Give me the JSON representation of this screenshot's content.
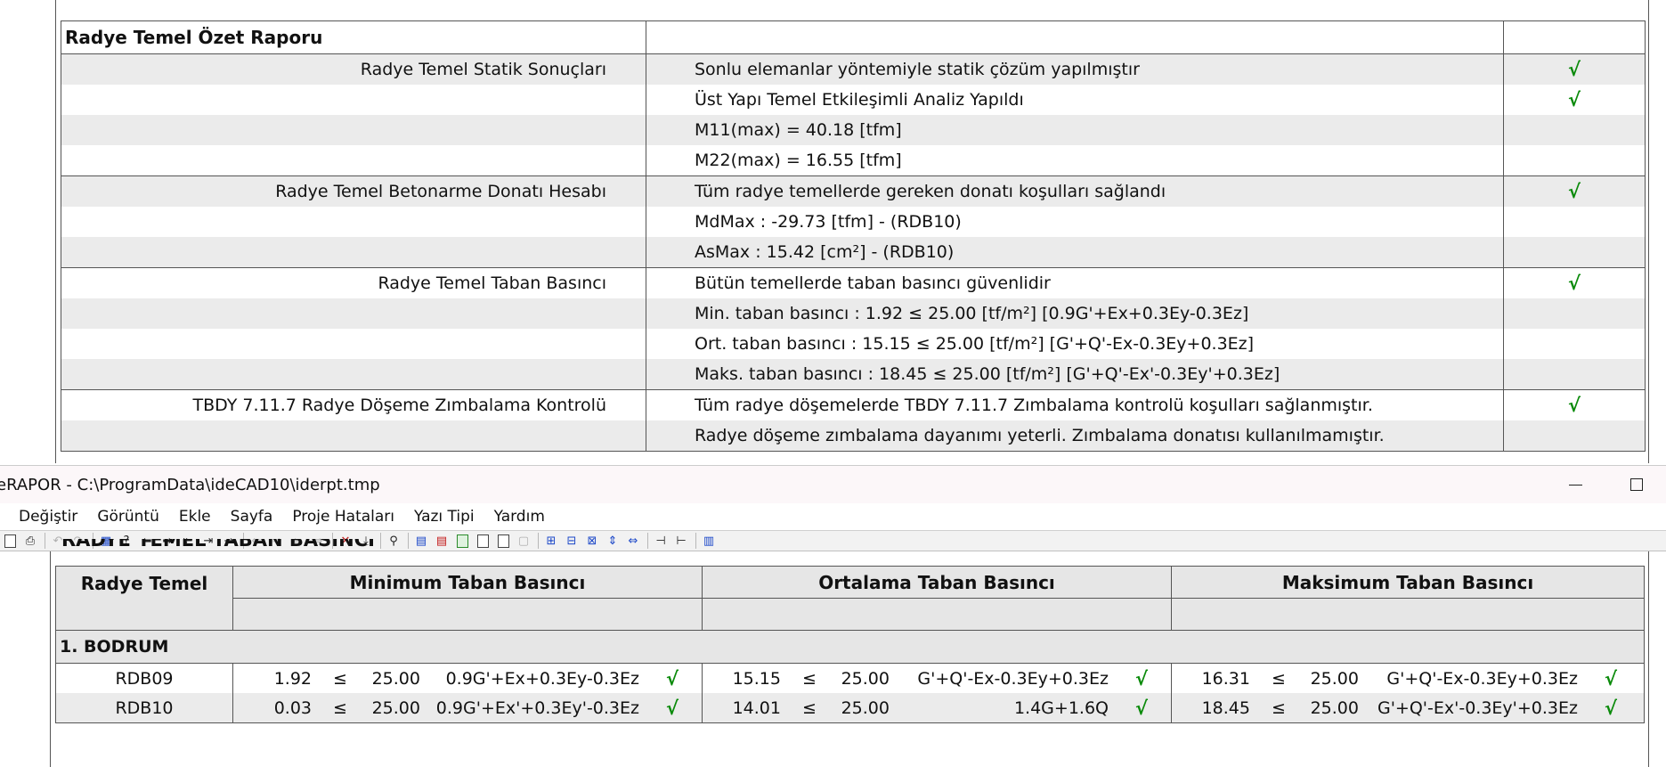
{
  "summary": {
    "title": "Radye Temel Özet Raporu",
    "sections": [
      {
        "label": "Radye Temel Statik Sonuçları",
        "lines": [
          {
            "text": "Sonlu elemanlar yöntemiyle statik çözüm yapılmıştır",
            "check": "√"
          },
          {
            "text": "Üst Yapı Temel Etkileşimli Analiz Yapıldı",
            "check": "√"
          },
          {
            "text": "M11(max) = 40.18 [tfm]",
            "check": ""
          },
          {
            "text": "M22(max) = 16.55 [tfm]",
            "check": ""
          }
        ]
      },
      {
        "label": "Radye Temel Betonarme Donatı Hesabı",
        "lines": [
          {
            "text": "Tüm radye temellerde gereken donatı koşulları sağlandı",
            "check": "√"
          },
          {
            "text": "MdMax : -29.73 [tfm] - (RDB10)",
            "check": ""
          },
          {
            "text": "AsMax : 15.42 [cm²] - (RDB10)",
            "check": ""
          }
        ]
      },
      {
        "label": "Radye Temel Taban Basıncı",
        "lines": [
          {
            "text": "Bütün temellerde taban basıncı güvenlidir",
            "check": "√"
          },
          {
            "text": "Min. taban basıncı : 1.92 ≤ 25.00 [tf/m²] [0.9G'+Ex+0.3Ey-0.3Ez]",
            "check": ""
          },
          {
            "text": "Ort. taban basıncı : 15.15 ≤ 25.00 [tf/m²] [G'+Q'-Ex-0.3Ey+0.3Ez]",
            "check": ""
          },
          {
            "text": "Maks. taban basıncı : 18.45 ≤ 25.00 [tf/m²] [G'+Q'-Ex'-0.3Ey'+0.3Ez]",
            "check": ""
          }
        ]
      },
      {
        "label": "TBDY 7.11.7 Radye Döşeme Zımbalama Kontrolü",
        "lines": [
          {
            "text": "Tüm radye döşemelerde TBDY 7.11.7 Zımbalama kontrolü koşulları sağlanmıştır.",
            "check": "√"
          },
          {
            "text": "Radye döşeme zımbalama dayanımı yeterli. Zımbalama donatısı kullanılmamıştır.",
            "check": ""
          }
        ]
      }
    ]
  },
  "window": {
    "title": "eRAPOR - C:\\ProgramData\\ideCAD10\\iderpt.tmp"
  },
  "menu": [
    "Değiştir",
    "Görüntü",
    "Ekle",
    "Sayfa",
    "Proje Hataları",
    "Yazı Tipi",
    "Yardım"
  ],
  "toolbar_icons": [
    "print-preview-icon",
    "print-icon",
    "undo-icon",
    "redo-icon",
    "table-icon",
    "help-icon",
    "arrow-left-icon",
    "arrow-right-icon",
    "first-icon",
    "last-icon",
    "goto-icon",
    "nav-left-icon",
    "nav-right-icon",
    "nav-first-icon",
    "nav-last-icon",
    "delete-icon",
    "insert-icon",
    "tree-icon",
    "page-icon-1",
    "page-icon-2",
    "page-icon-3",
    "page-icon-4",
    "page-icon-5",
    "page-icon-6",
    "zoom-icon-1",
    "zoom-icon-2",
    "zoom-icon-3",
    "zoom-icon-4",
    "zoom-icon-5",
    "fit-width-icon",
    "fit-page-icon",
    "columns-icon"
  ],
  "pressure_table": {
    "cut_heading": "RADYE TEMEL TABAN BASINCI",
    "col0": "Radye Temel",
    "groups": [
      "Minimum Taban Basıncı",
      "Ortalama Taban Basıncı",
      "Maksimum Taban Basıncı"
    ],
    "floor": "1. BODRUM",
    "le": "≤",
    "rows": [
      {
        "name": "RDB09",
        "min": {
          "value": "1.92",
          "limit": "25.00",
          "combo": "0.9G'+Ex+0.3Ey-0.3Ez",
          "ok": "√"
        },
        "avg": {
          "value": "15.15",
          "limit": "25.00",
          "combo": "G'+Q'-Ex-0.3Ey+0.3Ez",
          "ok": "√"
        },
        "max": {
          "value": "16.31",
          "limit": "25.00",
          "combo": "G'+Q'-Ex-0.3Ey+0.3Ez",
          "ok": "√"
        }
      },
      {
        "name": "RDB10",
        "min": {
          "value": "0.03",
          "limit": "25.00",
          "combo": "0.9G'+Ex'+0.3Ey'-0.3Ez",
          "ok": "√"
        },
        "avg": {
          "value": "14.01",
          "limit": "25.00",
          "combo": "1.4G+1.6Q",
          "ok": "√"
        },
        "max": {
          "value": "18.45",
          "limit": "25.00",
          "combo": "G'+Q'-Ex'-0.3Ey'+0.3Ez",
          "ok": "√"
        }
      }
    ]
  }
}
